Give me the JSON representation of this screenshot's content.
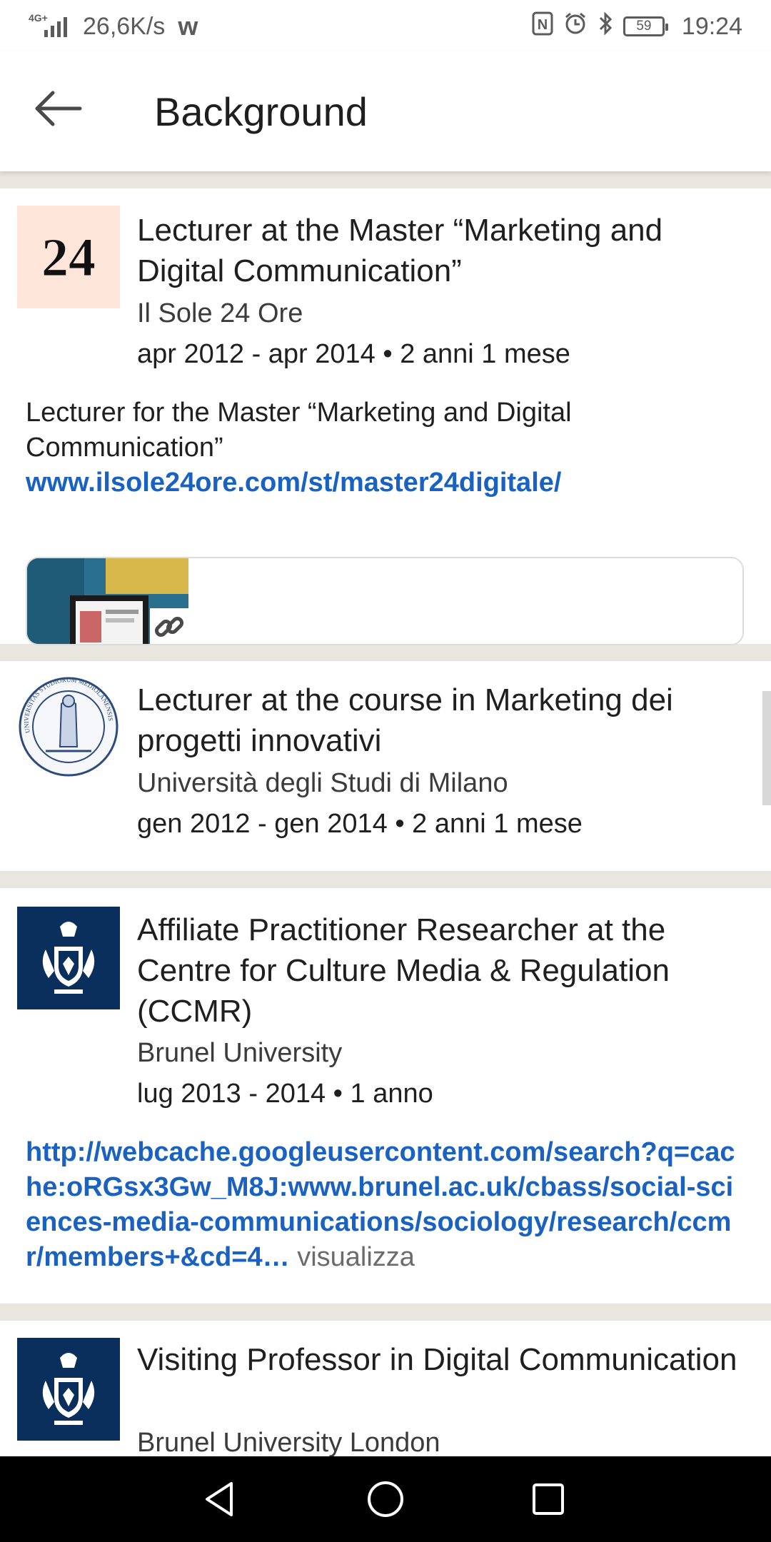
{
  "status_bar": {
    "network_label": "4G+",
    "speed": "26,6K/s",
    "app_glyph": "w",
    "nfc_label": "N",
    "battery": "59",
    "time": "19:24"
  },
  "header": {
    "title": "Background",
    "back_icon": "arrow-left-icon"
  },
  "entries": [
    {
      "logo_text": "24",
      "logo_bg": "#fde5d9",
      "title": "Lecturer at the Master “Marketing and Digital Communication”",
      "company": "Il Sole 24 Ore",
      "dates": "apr 2012 - apr 2014 • 2 anni 1 mese",
      "description": "Lecturer for the Master “Marketing and Digital Communication”",
      "link": "www.ilsole24ore.com/st/master24digitale/",
      "media_icon": "link-icon"
    },
    {
      "logo_text": "UNIVERSITAS STUDIORUM MEDIOLANENSIS",
      "title": "Lecturer at the course in Marketing dei progetti innovativi",
      "company": "Università degli Studi di Milano",
      "dates": "gen 2012 - gen 2014 • 2 anni 1 mese"
    },
    {
      "logo_bg": "#0b2f5c",
      "title": "Affiliate Practitioner Researcher at the Centre for Culture Media & Regulation (CCMR)",
      "company": "Brunel University",
      "dates": "lug 2013 - 2014 • 1 anno",
      "link": "http://webcache.googleusercontent.com/search?q=cache:oRGsx3Gw_M8J:www.brunel.ac.uk/cbass/social-sciences-media-communications/sociology/research/ccmr/members+&cd=4",
      "ellipsis": "…",
      "more_label": "visualizza"
    },
    {
      "logo_bg": "#0b2f5c",
      "title": "Visiting Professor in Digital Communication",
      "company": "Brunel University London"
    }
  ],
  "colors": {
    "link": "#1a62c1",
    "divider": "#e9e6df"
  },
  "nav_bar": {
    "back": "triangle-back-icon",
    "home": "circle-home-icon",
    "recents": "square-recents-icon"
  }
}
